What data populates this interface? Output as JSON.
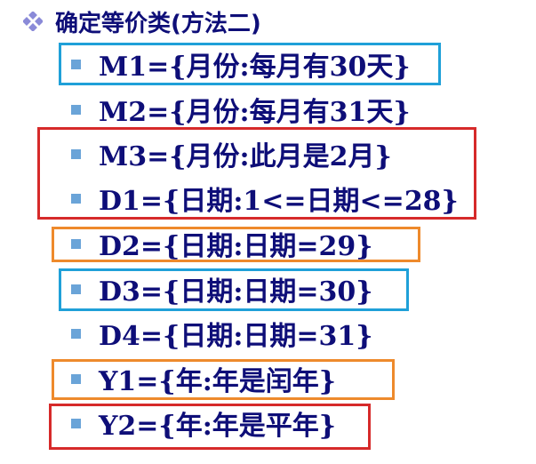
{
  "heading": {
    "text": "确定等价类(方法二)",
    "bullet_icon": "diamond-cluster-icon",
    "bullet_color": "#8a8ad8"
  },
  "items": [
    {
      "text": "M1={月份:每月有30天}"
    },
    {
      "text": "M2={月份:每月有31天}"
    },
    {
      "text": "M3={月份:此月是2月}"
    },
    {
      "text": "D1={日期:1<=日期<=28}"
    },
    {
      "text": "D2={日期:日期=29}"
    },
    {
      "text": "D3={日期:日期=30}"
    },
    {
      "text": "D4={日期:日期=31}"
    },
    {
      "text": "Y1={年:年是闰年}"
    },
    {
      "text": "Y2={年:年是平年}"
    }
  ],
  "colors": {
    "text": "#0e0e78",
    "bullet": "#6aa4d8",
    "highlight_blue": "#1fa0d8",
    "highlight_red": "#d62a2a",
    "highlight_orange": "#ee8a2c"
  }
}
